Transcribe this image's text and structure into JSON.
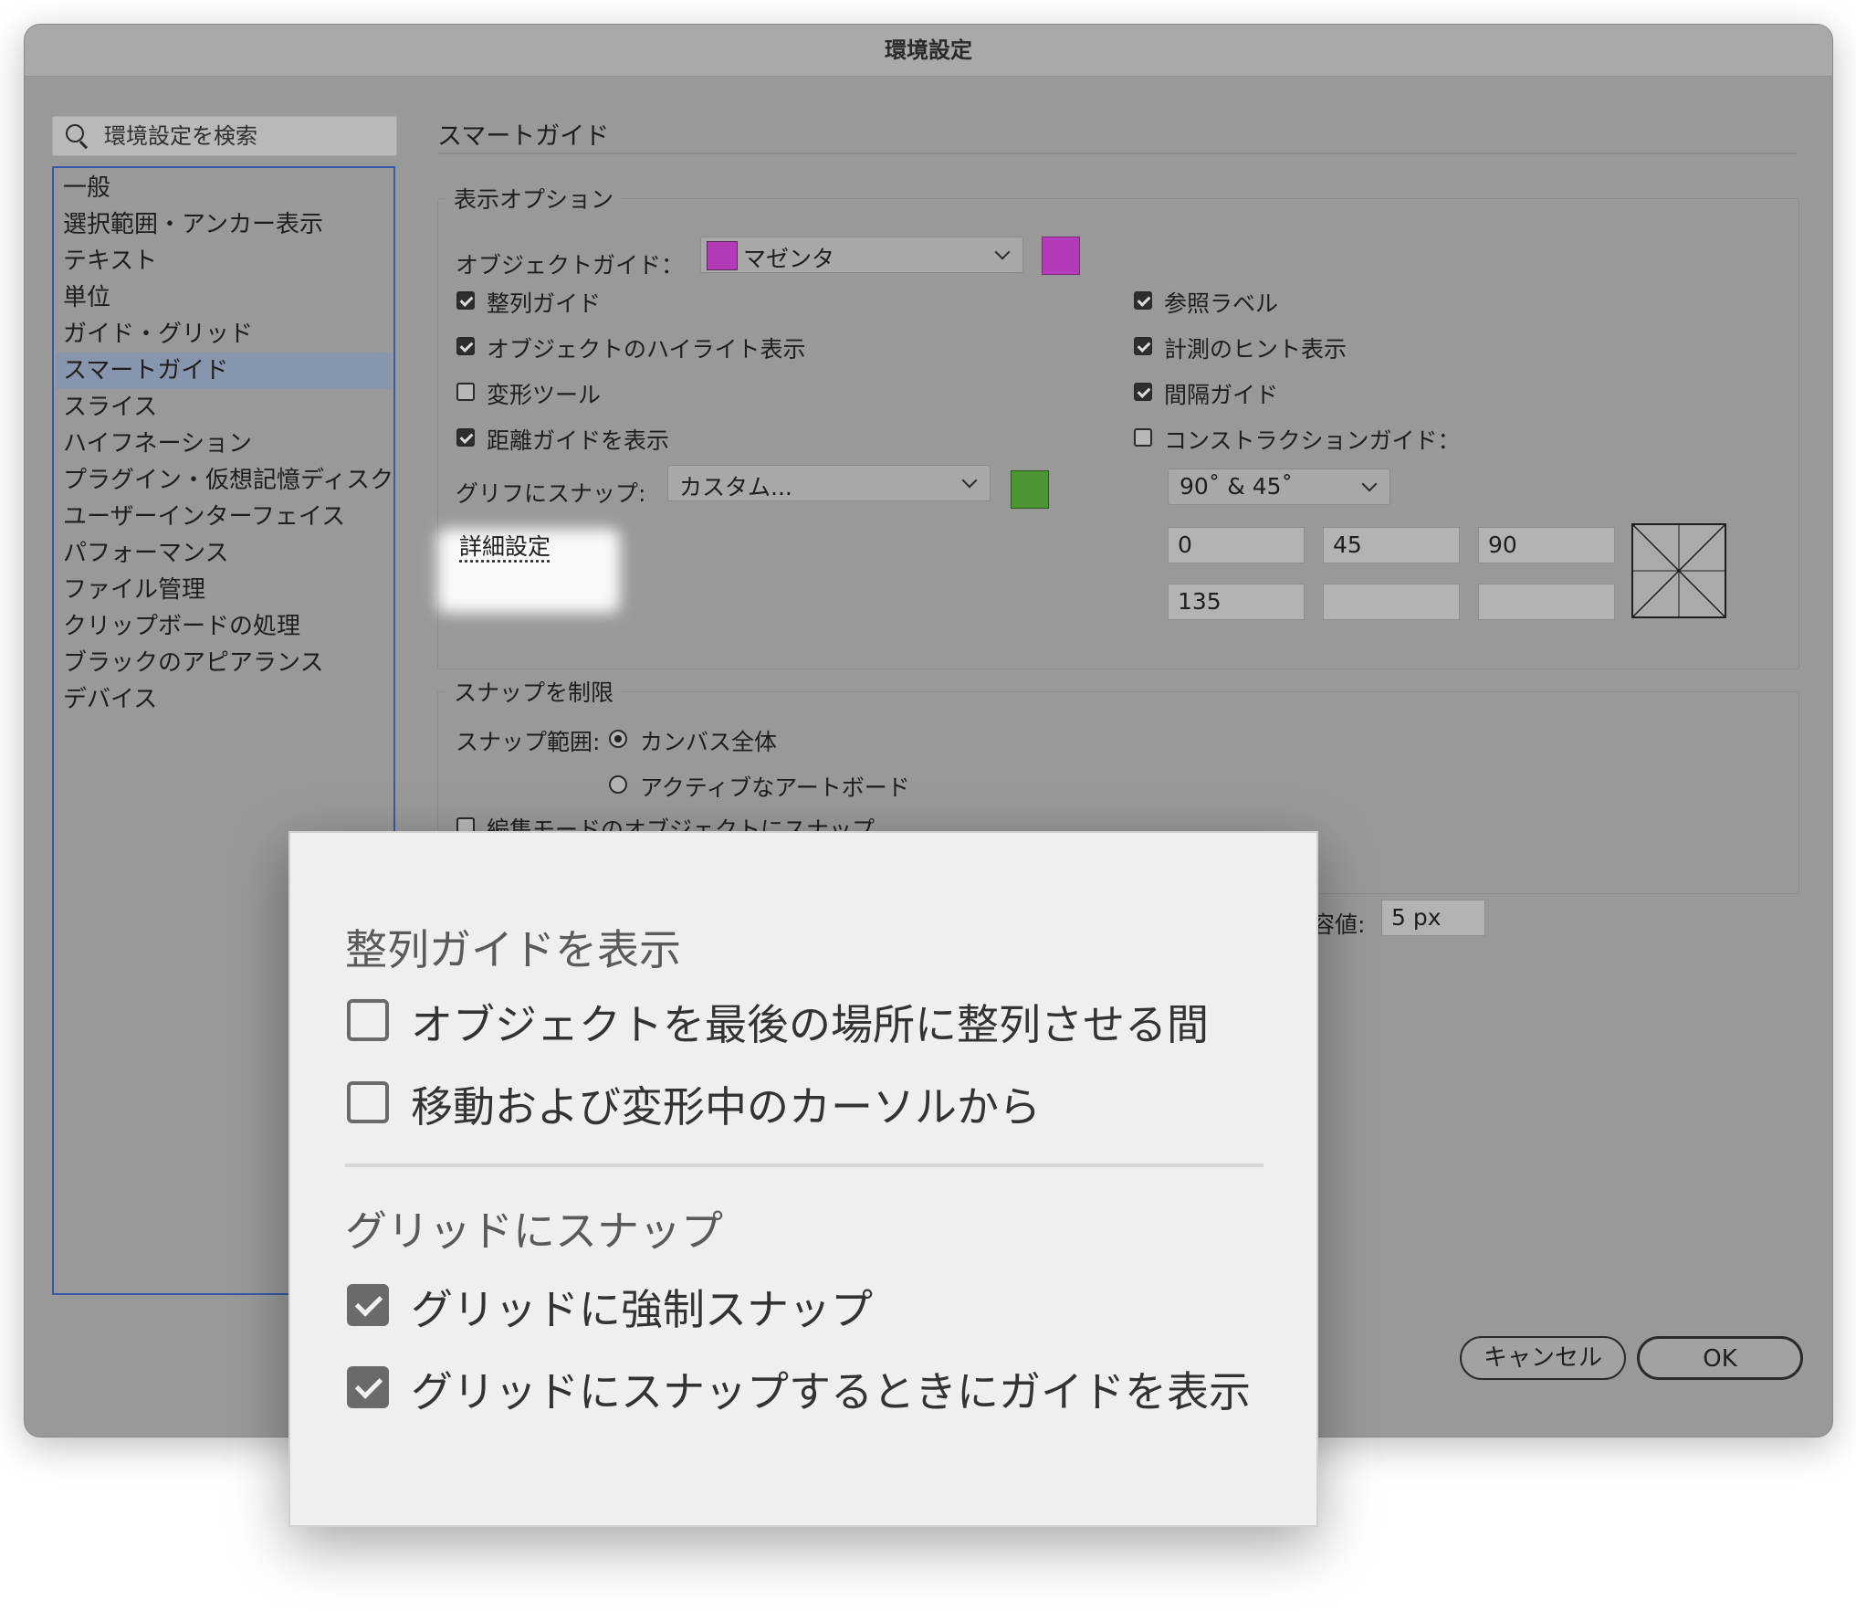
{
  "window": {
    "title": "環境設定"
  },
  "search": {
    "placeholder": "環境設定を検索"
  },
  "sidebar": {
    "items": [
      {
        "label": "一般"
      },
      {
        "label": "選択範囲・アンカー表示"
      },
      {
        "label": "テキスト"
      },
      {
        "label": "単位"
      },
      {
        "label": "ガイド・グリッド"
      },
      {
        "label": "スマートガイド",
        "selected": true
      },
      {
        "label": "スライス"
      },
      {
        "label": "ハイフネーション"
      },
      {
        "label": "プラグイン・仮想記憶ディスク"
      },
      {
        "label": "ユーザーインターフェイス"
      },
      {
        "label": "パフォーマンス"
      },
      {
        "label": "ファイル管理"
      },
      {
        "label": "クリップボードの処理"
      },
      {
        "label": "ブラックのアピアランス"
      },
      {
        "label": "デバイス"
      }
    ]
  },
  "main": {
    "title": "スマートガイド",
    "display": {
      "legend": "表示オプション",
      "object_guide_label": "オブジェクトガイド：",
      "object_guide_value": "マゼンタ",
      "object_guide_color": "#b43bb7",
      "left_checks": [
        {
          "label": "整列ガイド",
          "checked": true
        },
        {
          "label": "オブジェクトのハイライト表示",
          "checked": true
        },
        {
          "label": "変形ツール",
          "checked": false
        },
        {
          "label": "距離ガイドを表示",
          "checked": true
        }
      ],
      "right_checks": [
        {
          "label": "参照ラベル",
          "checked": true
        },
        {
          "label": "計測のヒント表示",
          "checked": true
        },
        {
          "label": "間隔ガイド",
          "checked": true
        },
        {
          "label": "コンストラクションガイド：",
          "checked": false
        }
      ],
      "glyph_snap_label": "グリフにスナップ:",
      "glyph_snap_value": "カスタム...",
      "glyph_snap_color": "#4b9431",
      "advanced_link": "詳細設定",
      "angle_select": "90˚ & 45˚",
      "angles": [
        "0",
        "45",
        "90",
        "135",
        "",
        ""
      ]
    },
    "snap": {
      "legend": "スナップを制限",
      "range_label": "スナップ範囲:",
      "range_options": [
        {
          "label": "カンバス全体",
          "selected": true
        },
        {
          "label": "アクティブなアートボード",
          "selected": false
        }
      ],
      "edit_mode_check": "編集モードのオブジェクトにスナップ",
      "tolerance_label": "許容値:",
      "tolerance_visible": "容値:",
      "tolerance_value": "5 px"
    }
  },
  "buttons": {
    "cancel": "キャンセル",
    "ok": "OK"
  },
  "popup": {
    "section1_title": "整列ガイドを表示",
    "section1_items": [
      {
        "label": "オブジェクトを最後の場所に整列させる間",
        "checked": false
      },
      {
        "label": "移動および変形中のカーソルから",
        "checked": false
      }
    ],
    "section2_title": "グリッドにスナップ",
    "section2_items": [
      {
        "label": "グリッドに強制スナップ",
        "checked": true
      },
      {
        "label": "グリッドにスナップするときにガイドを表示",
        "checked": true
      }
    ]
  }
}
